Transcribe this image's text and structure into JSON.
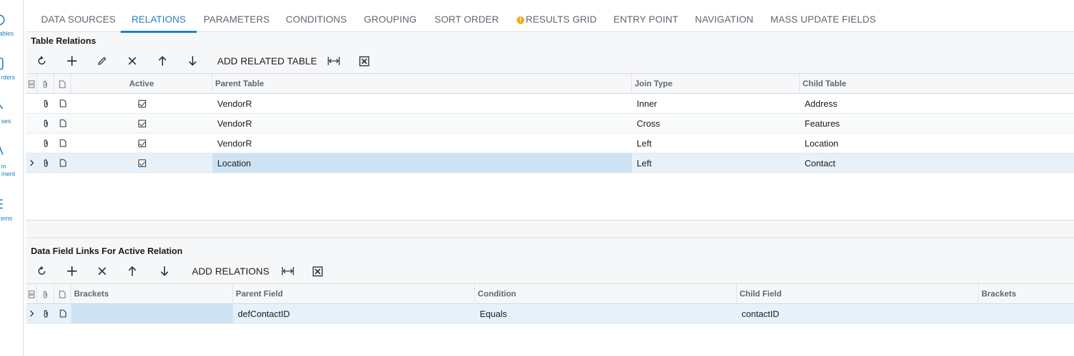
{
  "leftnav": {
    "items": [
      {
        "label": "ables",
        "icon": "circle-icon"
      },
      {
        "label": "rders",
        "icon": "document-icon"
      },
      {
        "label": "ses",
        "icon": "chart-icon"
      },
      {
        "label": "m",
        "label2": "ment",
        "icon": "person-icon"
      },
      {
        "label": "ems",
        "icon": "list-icon"
      }
    ]
  },
  "tabs": [
    {
      "label": "DATA SOURCES"
    },
    {
      "label": "RELATIONS"
    },
    {
      "label": "PARAMETERS"
    },
    {
      "label": "CONDITIONS"
    },
    {
      "label": "GROUPING"
    },
    {
      "label": "SORT ORDER"
    },
    {
      "label": "RESULTS GRID",
      "warning_icon": "warning-icon"
    },
    {
      "label": "ENTRY POINT"
    },
    {
      "label": "NAVIGATION"
    },
    {
      "label": "MASS UPDATE FIELDS"
    }
  ],
  "active_tab": "RELATIONS",
  "table_relations": {
    "title": "Table Relations",
    "toolbar": {
      "refresh_icon": "refresh-icon",
      "add_icon": "plus-icon",
      "edit_icon": "pencil-icon",
      "delete_icon": "close-icon",
      "up_icon": "arrow-up-icon",
      "down_icon": "arrow-down-icon",
      "add_related_label": "ADD RELATED TABLE",
      "fit_icon": "fit-columns-icon",
      "export_icon": "excel-export-icon"
    },
    "columns": {
      "active": "Active",
      "parent_table": "Parent Table",
      "join_type": "Join Type",
      "child_table": "Child Table"
    },
    "rows": [
      {
        "active": true,
        "parent": "VendorR",
        "join": "Inner",
        "child": "Address"
      },
      {
        "active": true,
        "parent": "VendorR",
        "join": "Cross",
        "child": "Features"
      },
      {
        "active": true,
        "parent": "VendorR",
        "join": "Left",
        "child": "Location"
      },
      {
        "active": true,
        "parent": "Location",
        "join": "Left",
        "child": "Contact",
        "selected": true
      }
    ]
  },
  "data_field_links": {
    "title": "Data Field Links For Active Relation",
    "toolbar": {
      "refresh_icon": "refresh-icon",
      "add_icon": "plus-icon",
      "delete_icon": "close-icon",
      "up_icon": "arrow-up-icon",
      "down_icon": "arrow-down-icon",
      "add_relations_label": "ADD RELATIONS",
      "fit_icon": "fit-columns-icon",
      "export_icon": "excel-export-icon"
    },
    "columns": {
      "brackets_open": "Brackets",
      "parent_field": "Parent Field",
      "condition": "Condition",
      "child_field": "Child Field",
      "brackets_close": "Brackets"
    },
    "rows": [
      {
        "brackets_open": "",
        "parent_field": "defContactID",
        "condition": "Equals",
        "child_field": "contactID",
        "brackets_close": "",
        "selected": true
      }
    ]
  },
  "colors": {
    "accent": "#1f7fbf",
    "selected_row": "#e6f1fa",
    "selected_cell": "#cde3f4",
    "warning": "#f2a81d"
  }
}
